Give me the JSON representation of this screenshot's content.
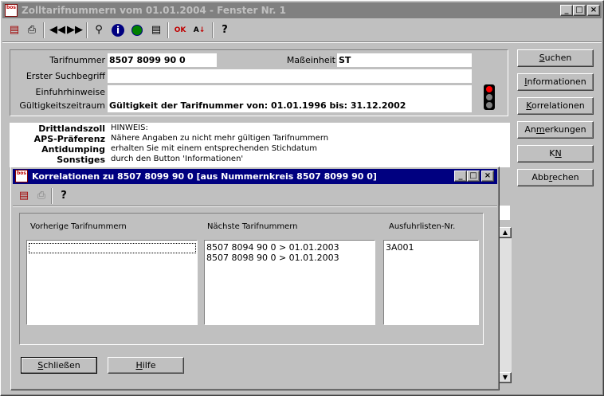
{
  "main_window": {
    "title": "Zolltarifnummern vom 01.01.2004 - Fenster Nr. 1",
    "app_icon_text": "bos",
    "minimize": "_",
    "maximize": "□",
    "close": "×"
  },
  "toolbar": {
    "icons": [
      "printer-out-icon",
      "print-icon",
      "rewind-icon",
      "forward-icon",
      "search-icon",
      "info-icon",
      "globe-icon",
      "comment-icon",
      "ok-check-icon",
      "sort-az-icon",
      "help-icon"
    ]
  },
  "form": {
    "tarifnummer_label": "Tarifnummer",
    "tarifnummer_value": "8507 8099 90 0",
    "masseinheit_label": "Maßeinheit",
    "masseinheit_value": "ST",
    "erster_suchbegriff_label": "Erster Suchbegriff",
    "erster_suchbegriff_value": "",
    "einfuhrhinweise_label": "Einfuhrhinweise",
    "einfuhrhinweise_value": "",
    "gueltigkeit_label": "Gültigkeitszeitraum",
    "gueltigkeit_value": "Gültigkeit der Tarifnummer von: 01.01.1996 bis: 31.12.2002"
  },
  "info_panel": {
    "labels": [
      "Drittlandszoll",
      "APS-Präferenz",
      "Antidumping",
      "Sonstiges"
    ],
    "lines": [
      "HINWEIS:",
      "Nähere Angaben zu nicht mehr gültigen Tarifnummern",
      "erhalten Sie mit einem entsprechenden Stichdatum",
      "durch den Button 'Informationen'"
    ]
  },
  "side_buttons": {
    "suchen_pre": "",
    "suchen_u": "S",
    "suchen_post": "uchen",
    "informationen_pre": "",
    "informationen_u": "I",
    "informationen_post": "nformationen",
    "korrelationen_pre": "",
    "korrelationen_u": "K",
    "korrelationen_post": "orrelationen",
    "anmerkungen_pre": "An",
    "anmerkungen_u": "m",
    "anmerkungen_post": "erkungen",
    "kn_pre": "K",
    "kn_u": "N",
    "kn_post": "",
    "abbrechen_pre": "Abb",
    "abbrechen_u": "r",
    "abbrechen_post": "echen"
  },
  "dialog": {
    "title": "Korrelationen zu 8507 8099 90 0 [aus Nummernkreis 8507 8099 90 0]",
    "app_icon_text": "bos",
    "minimize": "_",
    "maximize": "□",
    "close": "×",
    "col1_header": "Vorherige Tarifnummern",
    "col2_header": "Nächste Tarifnummern",
    "col3_header": "Ausfuhrlisten-Nr.",
    "next_numbers": [
      "8507 8094 90 0  > 01.01.2003",
      "8507 8098 90 0  > 01.01.2003"
    ],
    "ausfuhr": [
      "3A001"
    ],
    "close_pre": "",
    "close_u": "S",
    "close_post": "chließen",
    "help_pre": "",
    "help_u": "H",
    "help_post": "ilfe"
  }
}
